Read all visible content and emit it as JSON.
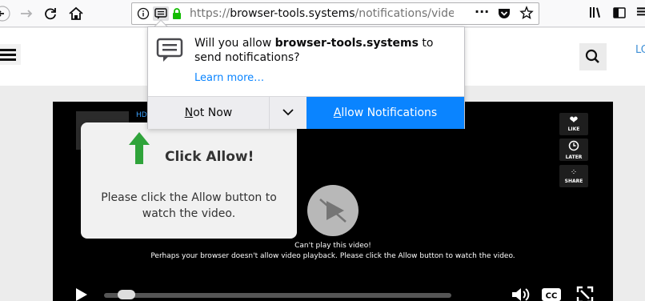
{
  "browser": {
    "url_scheme": "https://",
    "url_host": "browser-tools.systems",
    "url_path": "/notifications/video/"
  },
  "popup": {
    "message_prefix": "Will you allow ",
    "message_host": "browser-tools.systems",
    "message_suffix": " to send notifications?",
    "learn_more": "Learn more…",
    "not_now_first": "N",
    "not_now_rest": "ot Now",
    "allow_first": "A",
    "allow_rest": "llow Notifications"
  },
  "site": {
    "login_partial": "LO"
  },
  "player": {
    "hd_label": "HD",
    "like_label": "LIKE",
    "later_label": "LATER",
    "share_label": "SHARE",
    "cant_play": "Can't play this video!",
    "cant_play_detail": "Perhaps your browser doesn't allow video playback. Please click the Allow button to watch the video.",
    "progress_fraction": 0.04
  },
  "allow_card": {
    "title": "Click Allow!",
    "description": "Please click the Allow button to watch the video."
  },
  "colors": {
    "accent": "#0a84ff",
    "arrow_green": "#2fa33a",
    "player_bg": "#000000"
  },
  "icons": [
    "back-icon",
    "forward-icon",
    "reload-icon",
    "home-icon",
    "info-icon",
    "notification-icon",
    "lock-icon",
    "more-icon",
    "pocket-icon",
    "star-icon",
    "library-icon",
    "sidebar-icon",
    "hamburger-icon",
    "search-icon",
    "heart-icon",
    "clock-icon",
    "share-icon",
    "play-icon",
    "volume-icon",
    "cc-icon",
    "fullscreen-icon",
    "chevron-down-icon",
    "arrow-up-icon",
    "chat-bubble-icon"
  ]
}
